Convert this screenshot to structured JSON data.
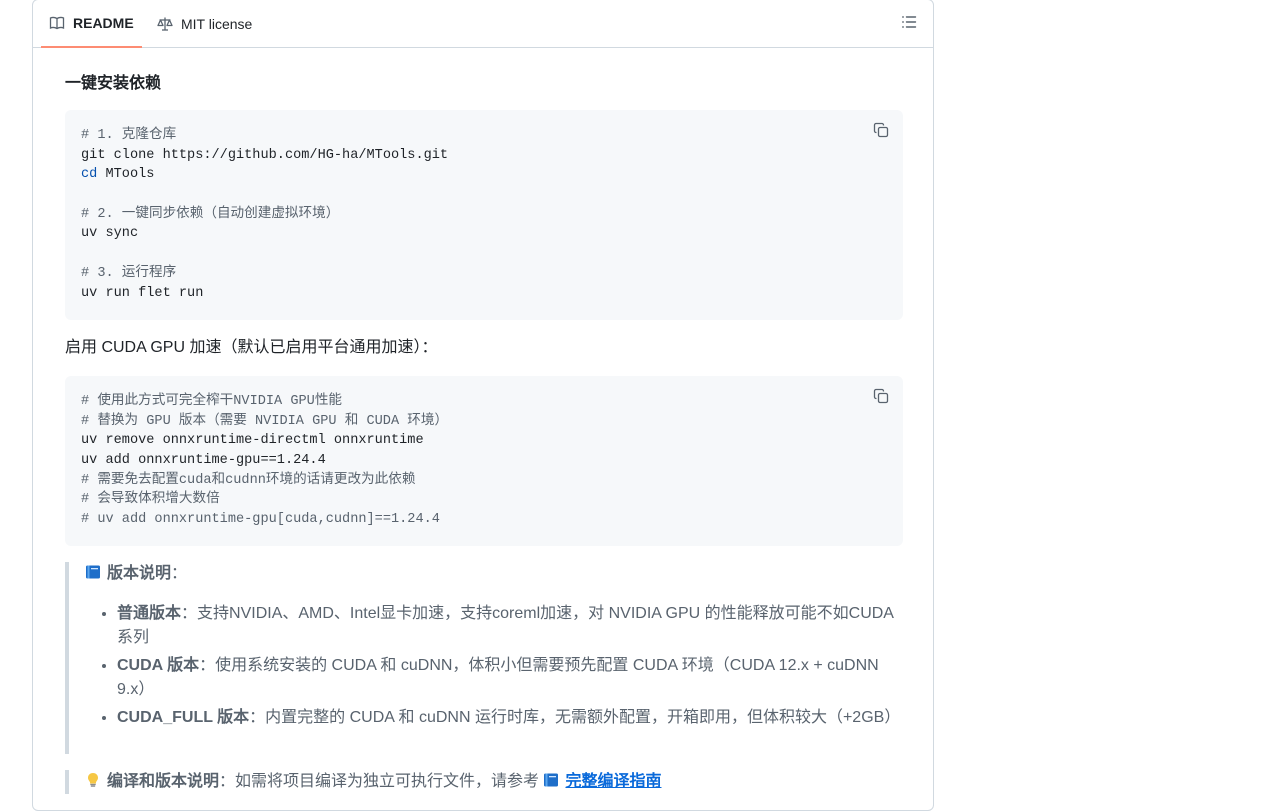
{
  "tabs": {
    "readme_label": "README",
    "license_label": "MIT license"
  },
  "install": {
    "heading": "一键安装依赖",
    "code_lines": [
      {
        "type": "comment",
        "text": "# 1. 克隆仓库"
      },
      {
        "type": "plain",
        "text": "git clone https://github.com/HG-ha/MTools.git"
      },
      {
        "type": "cd",
        "keyword": "cd",
        "text": " MTools"
      },
      {
        "type": "blank",
        "text": ""
      },
      {
        "type": "comment",
        "text": "# 2. 一键同步依赖（自动创建虚拟环境）"
      },
      {
        "type": "plain",
        "text": "uv sync"
      },
      {
        "type": "blank",
        "text": ""
      },
      {
        "type": "comment",
        "text": "# 3. 运行程序"
      },
      {
        "type": "plain",
        "text": "uv run flet run"
      }
    ]
  },
  "cuda": {
    "intro": "启用 CUDA GPU 加速（默认已启用平台通用加速）：",
    "code_lines": [
      {
        "type": "comment",
        "text": "# 使用此方式可完全榨干NVIDIA GPU性能"
      },
      {
        "type": "comment",
        "text": "# 替换为 GPU 版本（需要 NVIDIA GPU 和 CUDA 环境）"
      },
      {
        "type": "plain",
        "text": "uv remove onnxruntime-directml onnxruntime"
      },
      {
        "type": "plain",
        "text": "uv add onnxruntime-gpu==1.24.4"
      },
      {
        "type": "comment",
        "text": "# 需要免去配置cuda和cudnn环境的话请更改为此依赖"
      },
      {
        "type": "comment",
        "text": "# 会导致体积增大数倍"
      },
      {
        "type": "comment",
        "text": "# uv add onnxruntime-gpu[cuda,cudnn]==1.24.4"
      }
    ]
  },
  "version_note": {
    "icon": "blue-book-icon",
    "title": "版本说明",
    "colon": "：",
    "items": [
      {
        "name": "普通版本",
        "desc": "：支持NVIDIA、AMD、Intel显卡加速，支持coreml加速，对 NVIDIA GPU 的性能释放可能不如CUDA系列"
      },
      {
        "name": "CUDA 版本",
        "desc": "：使用系统安装的 CUDA 和 cuDNN，体积小但需要预先配置 CUDA 环境（CUDA 12.x + cuDNN 9.x）"
      },
      {
        "name": "CUDA_FULL 版本",
        "desc": "：内置完整的 CUDA 和 cuDNN 运行时库，无需额外配置，开箱即用，但体积较大（+2GB）"
      }
    ]
  },
  "build_note": {
    "icon": "light-bulb-icon",
    "title": "编译和版本说明",
    "text": "：如需将项目编译为独立可执行文件，请参考 ",
    "link_icon": "blue-book-icon",
    "link_label": "完整编译指南"
  },
  "colors": {
    "accent_tab": "#fd8c73",
    "link": "#0969da",
    "code_bg": "#f6f8fa",
    "border": "#d1d9e0"
  }
}
